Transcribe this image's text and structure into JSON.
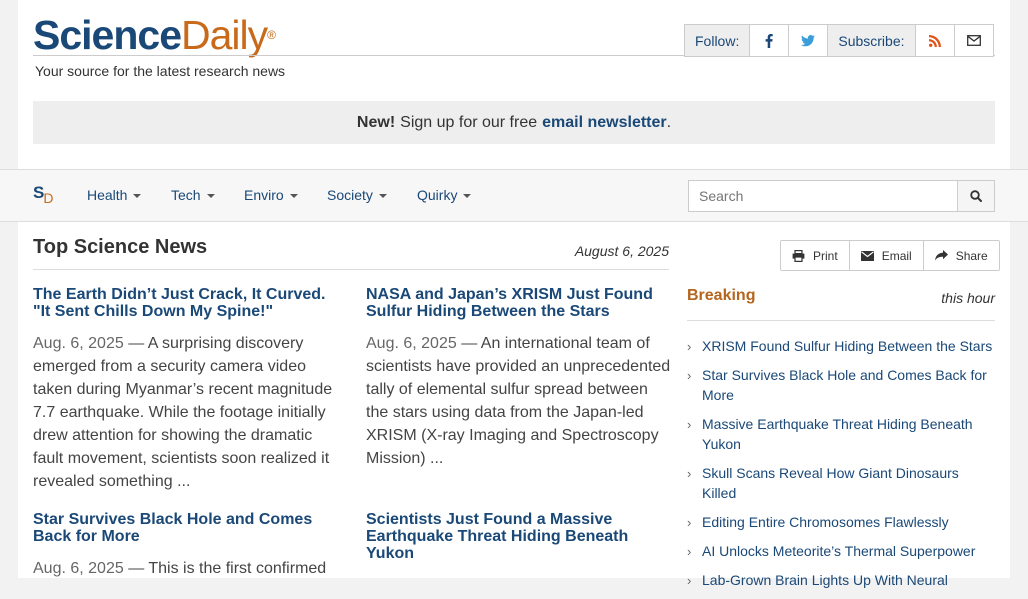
{
  "header": {
    "logo_science": "Science",
    "logo_daily": "Daily",
    "logo_reg": "®",
    "tagline": "Your source for the latest research news",
    "follow_label": "Follow:",
    "subscribe_label": "Subscribe:"
  },
  "newsletter": {
    "new_label": "New!",
    "text": "Sign up for our free",
    "link": "email newsletter",
    "end": "."
  },
  "nav": {
    "mark_s": "S",
    "mark_d": "D",
    "items": [
      "Health",
      "Tech",
      "Enviro",
      "Society",
      "Quirky"
    ],
    "search_placeholder": "Search"
  },
  "main": {
    "title": "Top Science News",
    "date": "August 6, 2025",
    "stories": [
      {
        "title": "The Earth Didn’t Just Crack, It Curved. \"It Sent Chills Down My Spine!\"",
        "date": "Aug. 6, 2025",
        "sep": " — ",
        "summary": "A surprising discovery emerged from a security camera video taken during Myanmar’s recent magnitude 7.7 earthquake. While the footage initially drew attention for showing the dramatic fault movement, scientists soon realized it revealed something ..."
      },
      {
        "title": "NASA and Japan’s XRISM Just Found Sulfur Hiding Between the Stars",
        "date": "Aug. 6, 2025",
        "sep": " — ",
        "summary": "An international team of scientists have provided an unprecedented tally of elemental sulfur spread between the stars using data from the Japan-led XRISM (X-ray Imaging and Spectroscopy Mission) ..."
      },
      {
        "title": "Star Survives Black Hole and Comes Back for More",
        "date": "Aug. 6, 2025",
        "sep": " — ",
        "summary": "This is the first confirmed"
      },
      {
        "title": "Scientists Just Found a Massive Earthquake Threat Hiding Beneath Yukon",
        "date": "",
        "sep": "",
        "summary": ""
      }
    ]
  },
  "share": {
    "print": "Print",
    "email": "Email",
    "share": "Share"
  },
  "breaking": {
    "title": "Breaking",
    "subtitle": "this hour",
    "items": [
      "XRISM Found Sulfur Hiding Between the Stars",
      "Star Survives Black Hole and Comes Back for More",
      "Massive Earthquake Threat Hiding Beneath Yukon",
      "Skull Scans Reveal How Giant Dinosaurs Killed",
      "Editing Entire Chromosomes Flawlessly",
      "AI Unlocks Meteorite’s Thermal Superpower",
      "Lab-Grown Brain Lights Up With Neural"
    ]
  },
  "colors": {
    "brand_blue": "#1a4877",
    "brand_orange": "#c86a1a",
    "breaking": "#b5651d"
  }
}
